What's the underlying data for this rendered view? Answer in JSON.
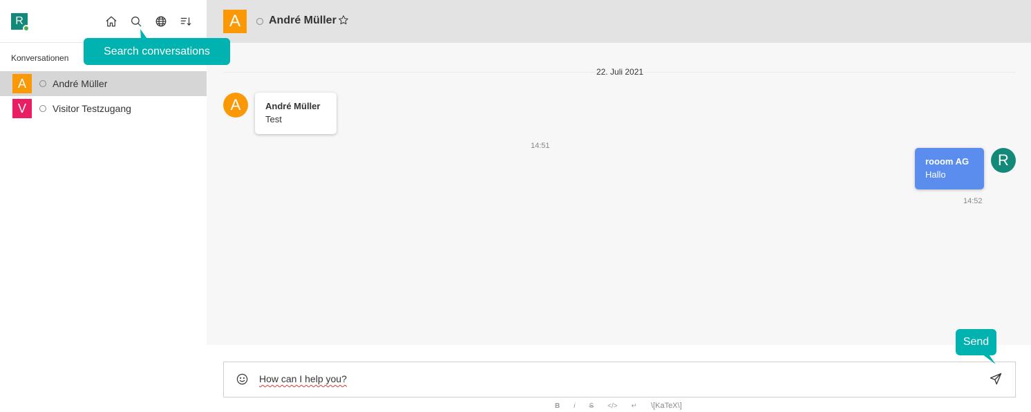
{
  "user": {
    "initial": "R",
    "avatar_color": "#13897a",
    "status_color": "#4caf50"
  },
  "sidebar": {
    "icons": [
      "home-icon",
      "search-icon",
      "globe-icon",
      "sort-icon"
    ],
    "section_title": "Konversationen",
    "conversations": [
      {
        "initial": "A",
        "name": "André Müller",
        "color": "#fb9805",
        "active": true
      },
      {
        "initial": "V",
        "name": "Visitor Testzugang",
        "color": "#e91e63",
        "active": false
      }
    ]
  },
  "tooltips": {
    "search": "Search conversations",
    "send": "Send",
    "color": "#00b3b0"
  },
  "header": {
    "initial": "A",
    "name": "André Müller",
    "avatar_color": "#fb9805"
  },
  "messages": {
    "date": "22. Juli 2021",
    "items": [
      {
        "side": "left",
        "initial": "A",
        "avatar_color": "#fb9805",
        "sender": "André Müller",
        "text": "Test",
        "time": "14:51"
      },
      {
        "side": "right",
        "initial": "R",
        "avatar_color": "#13897a",
        "bubble_color": "#5b8def",
        "sender": "rooom AG",
        "text": "Hallo",
        "time": "14:52"
      }
    ]
  },
  "composer": {
    "text": "How can I help you?",
    "format_buttons": [
      "B",
      "i",
      "S",
      "</>",
      "↵"
    ],
    "katex_label": "\\[KaTeX\\]"
  }
}
